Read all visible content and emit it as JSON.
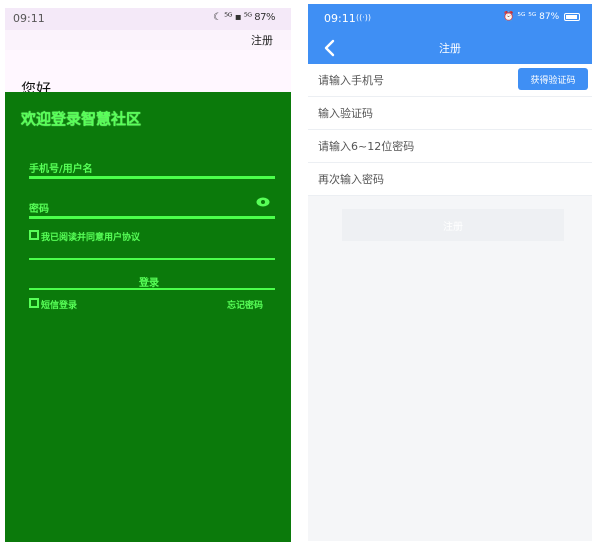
{
  "left": {
    "statusbar": {
      "time": "09:11",
      "icons": "☾ ⁵ᴳ ▪ ⁵ᴳ 87%"
    },
    "header": {
      "register_link": "注册"
    },
    "hello": "您好",
    "welcome": "欢迎登录智慧社区",
    "phone_label": "手机号/用户名",
    "password_label": "密码",
    "agree_label": "我已阅读并同意用户协议",
    "login_button": "登录",
    "sms_login": "短信登录",
    "forgot_password": "忘记密码"
  },
  "right": {
    "statusbar": {
      "time": "09:11",
      "icons": "⏰ ⁵ᴳ ⁵ᴳ 87%"
    },
    "navbar": {
      "title": "注册"
    },
    "form": {
      "phone_placeholder": "请输入手机号",
      "get_code_label": "获得验证码",
      "code_placeholder": "输入验证码",
      "password_placeholder": "请输入6~12位密码",
      "password_confirm_placeholder": "再次输入密码",
      "register_label": "注册"
    }
  },
  "colors": {
    "accent": "#3f8ff4",
    "glitch_green": "#0b7a0b",
    "glitch_bright": "#58ff58",
    "page_bg": "#f5f6f8"
  }
}
